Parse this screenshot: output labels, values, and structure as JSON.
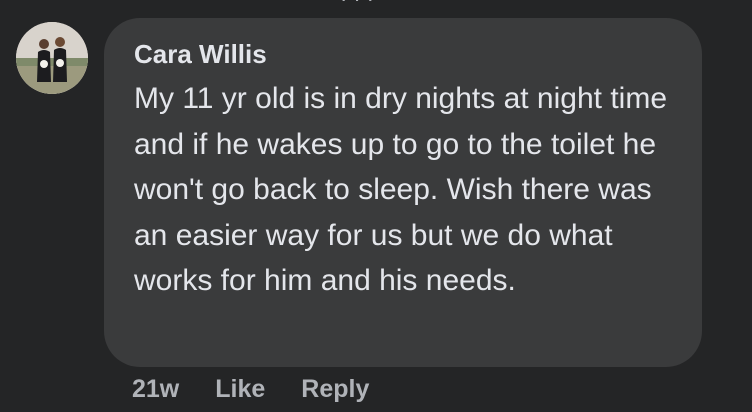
{
  "comment": {
    "author": "Cara Willis",
    "text": "My 11 yr old is in dry nights at night time and if he wakes up to go to the toilet he won't go back to sleep. Wish there was an easier way for us but we do what works for him and his needs.",
    "timestamp": "21w",
    "like_label": "Like",
    "reply_label": "Reply",
    "avatar_icon": "profile-photo"
  },
  "colors": {
    "background": "#242526",
    "bubble": "#3a3b3c",
    "primary_text": "#e4e6eb",
    "secondary_text": "#b0b3b8"
  }
}
